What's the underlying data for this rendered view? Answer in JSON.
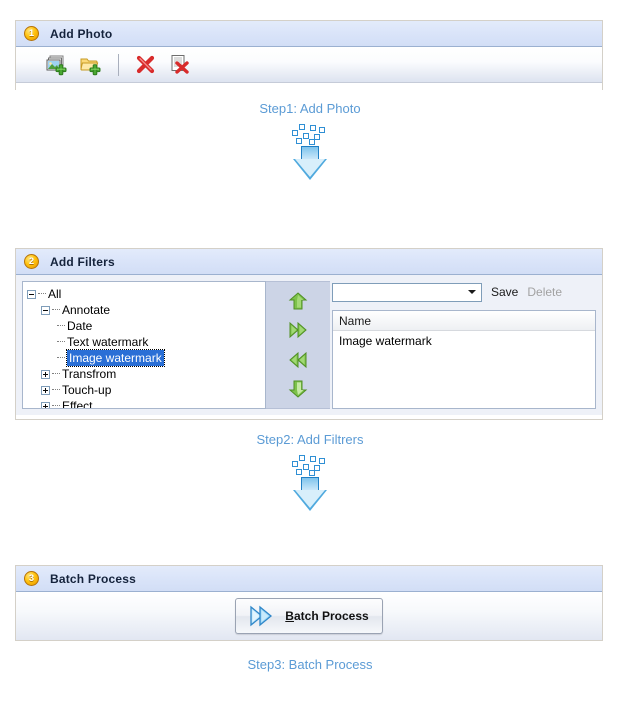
{
  "steps": [
    {
      "number": "1",
      "title": "Add Photo",
      "caption": "Step1: Add Photo",
      "toolbar": [
        {
          "name": "add-photo-icon",
          "tooltip": "Add Photo"
        },
        {
          "name": "add-folder-icon",
          "tooltip": "Add Folder"
        },
        {
          "name": "remove-icon",
          "tooltip": "Remove"
        },
        {
          "name": "remove-all-icon",
          "tooltip": "Remove All"
        }
      ]
    },
    {
      "number": "2",
      "title": "Add Filters",
      "caption": "Step2: Add Filtrers"
    },
    {
      "number": "3",
      "title": "Batch Process",
      "caption": "Step3: Batch Process"
    }
  ],
  "tree": {
    "nodes": [
      {
        "label": "All",
        "level": 0,
        "expander": "minus",
        "selected": false
      },
      {
        "label": "Annotate",
        "level": 1,
        "expander": "minus",
        "selected": false
      },
      {
        "label": "Date",
        "level": 2,
        "expander": "none",
        "selected": false
      },
      {
        "label": "Text watermark",
        "level": 2,
        "expander": "none",
        "selected": false
      },
      {
        "label": "Image watermark",
        "level": 2,
        "expander": "none",
        "selected": true
      },
      {
        "label": "Transfrom",
        "level": 1,
        "expander": "plus",
        "selected": false
      },
      {
        "label": "Touch-up",
        "level": 1,
        "expander": "plus",
        "selected": false
      },
      {
        "label": "Effect",
        "level": 1,
        "expander": "plus",
        "selected": false
      }
    ]
  },
  "arrow_buttons": [
    {
      "name": "move-up-button",
      "glyph": "up"
    },
    {
      "name": "add-filter-button",
      "glyph": "double-right"
    },
    {
      "name": "remove-filter-button",
      "glyph": "double-left"
    },
    {
      "name": "move-down-button",
      "glyph": "down"
    }
  ],
  "preset": {
    "combo_value": "",
    "combo_placeholder": "",
    "save_label": "Save",
    "delete_label": "Delete",
    "delete_enabled": false
  },
  "filter_list": {
    "columns": [
      "Name"
    ],
    "rows": [
      {
        "name": "Image watermark"
      }
    ]
  },
  "batch": {
    "button_accel": "B",
    "button_rest": "atch Process"
  },
  "colors": {
    "step_caption": "#5b9bd5",
    "header_blue": "#dae4f9",
    "selection_blue": "#2a6fd6",
    "arrow_green": "#76c043",
    "badge_orange": "#ffc20e"
  }
}
